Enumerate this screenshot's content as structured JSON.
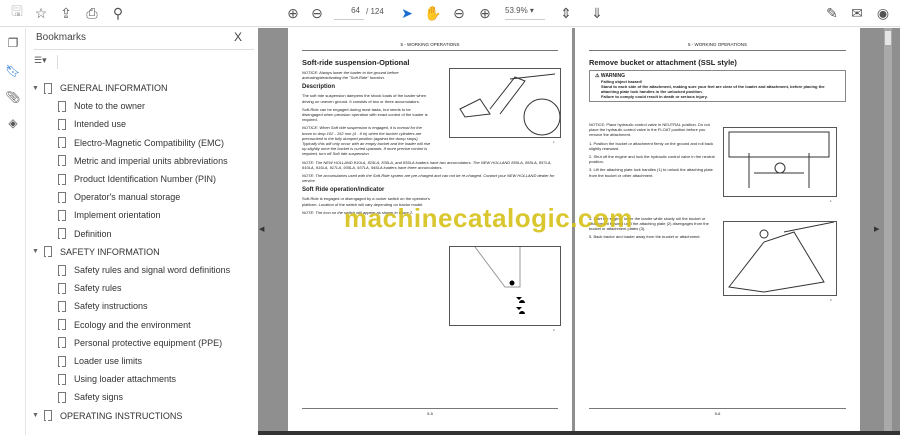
{
  "toolbar": {
    "page_current": "64",
    "page_total": "/ 124",
    "zoom": "53.9%"
  },
  "bookmarks": {
    "title": "Bookmarks",
    "close": "X",
    "items": [
      {
        "label": "GENERAL INFORMATION",
        "level": 0
      },
      {
        "label": "Note to the owner",
        "level": 1
      },
      {
        "label": "Intended use",
        "level": 1
      },
      {
        "label": "Electro-Magnetic Compatibility (EMC)",
        "level": 1
      },
      {
        "label": "Metric and imperial units abbreviations",
        "level": 1
      },
      {
        "label": "Product Identification Number (PIN)",
        "level": 1
      },
      {
        "label": "Operator's manual storage",
        "level": 1
      },
      {
        "label": "Implement orientation",
        "level": 1
      },
      {
        "label": "Definition",
        "level": 1
      },
      {
        "label": "SAFETY INFORMATION",
        "level": 0
      },
      {
        "label": "Safety rules and signal word definitions",
        "level": 1
      },
      {
        "label": "Safety rules",
        "level": 1
      },
      {
        "label": "Safety instructions",
        "level": 1
      },
      {
        "label": "Ecology and the environment",
        "level": 1
      },
      {
        "label": "Personal protective equipment (PPE)",
        "level": 1
      },
      {
        "label": "Loader use limits",
        "level": 1
      },
      {
        "label": "Using loader attachments",
        "level": 1
      },
      {
        "label": "Safety signs",
        "level": 1
      },
      {
        "label": "OPERATING INSTRUCTIONS",
        "level": 0
      }
    ]
  },
  "left_page": {
    "header": "5 - WORKING OPERATIONS",
    "title": "Soft-ride suspension-Optional",
    "notice1": "NOTICE: Always lower the loader to the ground before activating/deactivating the \"Soft-Ride\" function.",
    "desc_heading": "Description",
    "p1": "The soft ride suspension dampens the shock loads of the loader when driving on uneven ground. It consists of two or three accumulators.",
    "p2": "Soft-Ride can be engaged during most tasks, but needs to be disengaged when precision operation with exact control of the loader is required.",
    "notice2": "NOTICE: When Soft ride suspension is engaged, it is normal for the boom to drop 102 - 152 mm (4 - 6 in) when the bucket cylinders are precourized in the fully dumped position (against the dump stops). Typically this will only occur with an empty bucket and the loader will rise up slightly once the bucket is curled upwards. If more precise control is required, turn off Soft ride suspension",
    "note1": "NOTE: The NEW HOLLAND 810LA, 815LA, 830LA, and 835LA loaders have two accumulators. The NEW HOLLAND 850LA, 855LA, 857LA, 910LA, 915LA, 917LA, 935LA, 937LA, 945LA loaders have three accumulators.",
    "note2": "NOTE: The accumulators used with the Soft-Ride system are pre-charged and can not be re-charged. Contact your NEW HOLLAND dealer for service.",
    "sub_heading": "Soft Ride operation/indicator",
    "p3": "Soft-Ride is engaged or disengaged by a rocker switch on the operator's platform. Location of the switch will vary depending on tractor model.",
    "note3": "NOTE: The icon on the switch will appear as shown in figure 2.",
    "fig1_caption": "1",
    "fig2_caption": "2",
    "footer": "5-5"
  },
  "right_page": {
    "header": "5 - WORKING OPERATIONS",
    "title": "Remove bucket or attachment (SSL style)",
    "warning_title": "WARNING",
    "warning_lines": [
      "Falling object hazard!",
      "Stand to each side of the attachment, making sure your feet are clear of the loader and attachment, before placing the attaching plate lock handles in the unlocked position.",
      "Failure to comply could result in death or serious injury."
    ],
    "notice": "NOTICE: Place hydraulic control valve in NEUTRAL position. Do not place the hydraulic control valve in the FLOAT position before you remove the attachment.",
    "steps": [
      "1. Position the bucket or attachment firmly on the ground and roll back slightly rearward.",
      "2. Shut off the engine and lock the hydraulic control valve in the neutral position.",
      "3. Lift the attaching plate lock handles (1) to unlock the attaching plate from the bucket or other attachment.",
      "4. Start the engine, lower the loader while slowly roll the bucket or attachment forward until the attaching plate (2) disengages from the bucket or attachment plates (3).",
      "5. Back tractor and loader away from the bucket or attachment."
    ],
    "fig1_caption": "1",
    "fig2_caption": "2",
    "footer": "5-6"
  },
  "watermark": "machinecatalogic.com"
}
